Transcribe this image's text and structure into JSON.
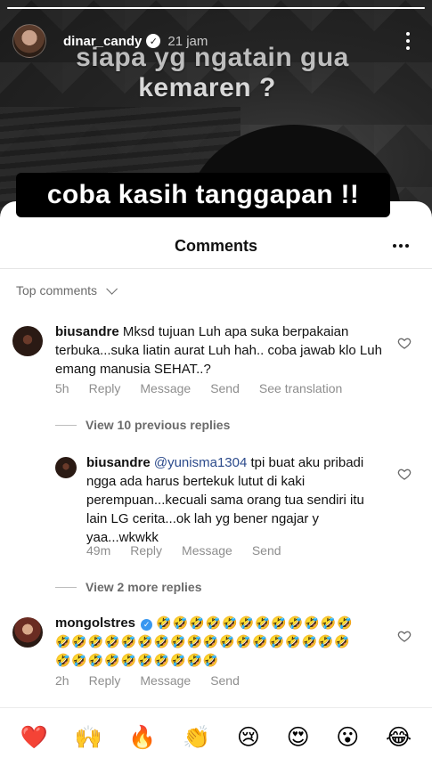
{
  "story": {
    "progress_fraction": 1.0,
    "username": "dinar_candy",
    "time_ago": "21 jam",
    "text_line1": "siapa yg ngatain gua",
    "text_line2": "kemaren ?",
    "sticker_text": "coba kasih tanggapan !!"
  },
  "sheet": {
    "title": "Comments",
    "sort_label": "Top comments"
  },
  "comments": [
    {
      "username": "biusandre",
      "text": "Mksd tujuan Luh apa suka berpakaian terbuka...suka liatin aurat Luh hah.. coba jawab klo Luh emang manusia SEHAT..?",
      "time": "5h",
      "actions": [
        "Reply",
        "Message",
        "Send",
        "See translation"
      ]
    },
    {
      "username": "biusandre",
      "mention": "@yunisma1304",
      "text": " tpi buat aku pribadi ngga ada harus bertekuk lutut di kaki perempuan...kecuali sama orang tua sendiri itu lain LG cerita...ok lah yg bener ngajar y yaa...wkwkk",
      "time": "49m",
      "actions": [
        "Reply",
        "Message",
        "Send"
      ]
    },
    {
      "username": "mongolstres",
      "text": "🤣🤣🤣🤣🤣🤣🤣🤣🤣🤣🤣🤣🤣🤣🤣🤣🤣🤣🤣🤣🤣🤣🤣🤣🤣🤣🤣🤣🤣🤣🤣🤣🤣🤣🤣🤣🤣🤣🤣🤣",
      "time": "2h",
      "actions": [
        "Reply",
        "Message",
        "Send"
      ]
    }
  ],
  "replies_links": {
    "first": "View 10 previous replies",
    "second": "View 2 more replies"
  },
  "reactions": [
    "❤️",
    "🙌",
    "🔥",
    "👏",
    "😢",
    "😍",
    "😮",
    "😂"
  ],
  "icons": {
    "verified": "verified-badge-icon",
    "more": "more-options-icon",
    "heart": "heart-outline-icon",
    "chevron": "chevron-down-icon"
  }
}
